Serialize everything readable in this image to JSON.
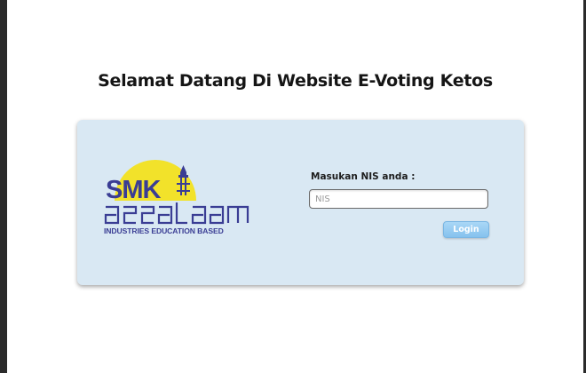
{
  "page": {
    "title": "Selamat Datang Di Website E-Voting Ketos"
  },
  "logo": {
    "brand": "SMK",
    "name": "assalaam",
    "caption": "INDUSTRIES EDUCATION BASED",
    "colors": {
      "sun": "#f2e22a",
      "text": "#3a3d94"
    }
  },
  "form": {
    "nis_label": "Masukan NIS anda :",
    "nis_placeholder": "NIS",
    "nis_value": "",
    "login_label": "Login"
  },
  "colors": {
    "card_background": "#d9e8f3",
    "login_button": "#86c2ee"
  }
}
